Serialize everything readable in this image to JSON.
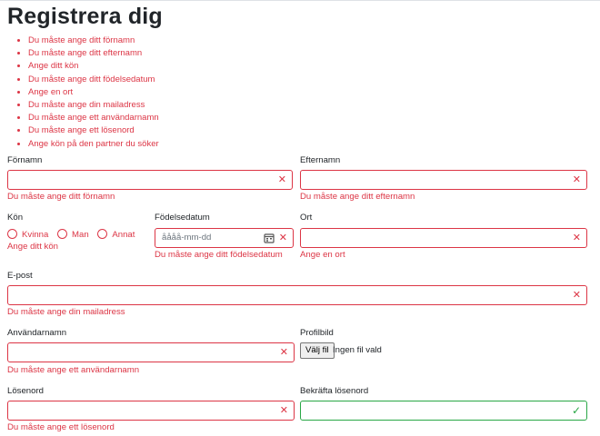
{
  "page": {
    "title": "Registrera dig"
  },
  "error_summary": [
    "Du måste ange ditt förnamn",
    "Du måste ange ditt efternamn",
    "Ange ditt kön",
    "Du måste ange ditt födelsedatum",
    "Ange en ort",
    "Du måste ange din mailadress",
    "Du måste ange ett användarnamn",
    "Du måste ange ett lösenord",
    "Ange kön på den partner du söker"
  ],
  "form": {
    "firstname": {
      "label": "Förnamn",
      "value": "",
      "error": "Du måste ange ditt förnamn"
    },
    "lastname": {
      "label": "Efternamn",
      "value": "",
      "error": "Du måste ange ditt efternamn"
    },
    "gender": {
      "label": "Kön",
      "options": [
        "Kvinna",
        "Man",
        "Annat"
      ],
      "error": "Ange ditt kön"
    },
    "birthdate": {
      "label": "Födelsedatum",
      "placeholder": "åååå-mm-dd",
      "error": "Du måste ange ditt födelsedatum"
    },
    "city": {
      "label": "Ort",
      "value": "",
      "error": "Ange en ort"
    },
    "email": {
      "label": "E-post",
      "value": "",
      "error": "Du måste ange din mailadress"
    },
    "username": {
      "label": "Användarnamn",
      "value": "",
      "error": "Du måste ange ett användarnamn"
    },
    "profile_picture": {
      "label": "Profilbild",
      "button": "Välj fil",
      "status": "Ingen fil vald"
    },
    "password": {
      "label": "Lösenord",
      "value": "",
      "error": "Du måste ange ett lösenord"
    },
    "confirm_password": {
      "label": "Bekräfta lösenord",
      "value": ""
    }
  },
  "icons": {
    "invalid": "✕",
    "valid": "✓",
    "calendar": "calendar-icon"
  },
  "colors": {
    "error": "#dc3545",
    "valid": "#28a745",
    "text": "#212529"
  }
}
